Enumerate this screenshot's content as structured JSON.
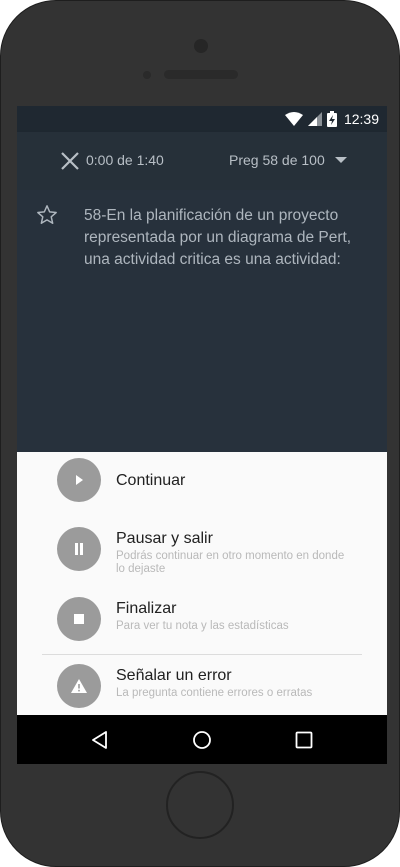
{
  "status_bar": {
    "time": "12:39",
    "icons": [
      "wifi-icon",
      "signal-icon",
      "battery-charging-icon"
    ]
  },
  "app_bar": {
    "close_icon": "close-icon",
    "timer": "0:00 de 1:40",
    "question_selector": "Preg 58 de 100",
    "dropdown_icon": "dropdown-arrow-icon"
  },
  "question": {
    "favorite_icon": "star-outline-icon",
    "text": "58-En la planificación de un proyecto representada por un diagrama de Pert, una actividad critica es una actividad:"
  },
  "menu": {
    "items": [
      {
        "icon": "play-icon",
        "label": "Continuar",
        "sublabel": ""
      },
      {
        "icon": "pause-icon",
        "label": "Pausar y salir",
        "sublabel": "Podrás continuar en otro momento en donde lo dejaste"
      },
      {
        "icon": "stop-icon",
        "label": "Finalizar",
        "sublabel": "Para ver tu nota y las estadísticas"
      },
      {
        "icon": "warning-icon",
        "label": "Señalar un error",
        "sublabel": "La pregunta contiene errores o erratas"
      }
    ]
  },
  "nav_bar": {
    "icons": [
      "back-icon",
      "home-icon",
      "recents-icon"
    ]
  },
  "colors": {
    "screen_background": "#27303b",
    "sheet_background": "#fafafa",
    "menu_icon_circle": "#9b9b9b",
    "nav_bar": "#000000"
  }
}
